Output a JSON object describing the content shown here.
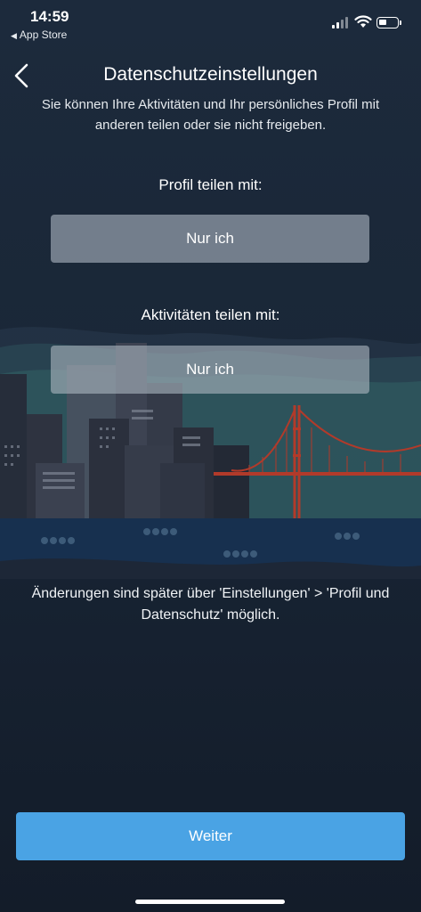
{
  "status_bar": {
    "time": "14:59",
    "back_app_label": "App Store"
  },
  "header": {
    "title": "Datenschutzeinstellungen",
    "subtitle": "Sie können Ihre Aktivitäten und Ihr persönliches Profil mit anderen teilen oder sie nicht freigeben."
  },
  "profile_sharing": {
    "label": "Profil teilen mit:",
    "value": "Nur ich"
  },
  "activity_sharing": {
    "label": "Aktivitäten teilen mit:",
    "value": "Nur ich"
  },
  "note": "Änderungen sind später über 'Einstellungen' > 'Profil und Datenschutz' möglich.",
  "continue_button": "Weiter",
  "colors": {
    "background": "#1a2737",
    "primary_button": "#4aa3e4",
    "bridge": "#b23a2a",
    "water": "#17304f"
  },
  "icons": {
    "back": "chevron-left-icon",
    "signal": "cellular-signal-icon",
    "wifi": "wifi-icon",
    "battery": "battery-icon"
  }
}
